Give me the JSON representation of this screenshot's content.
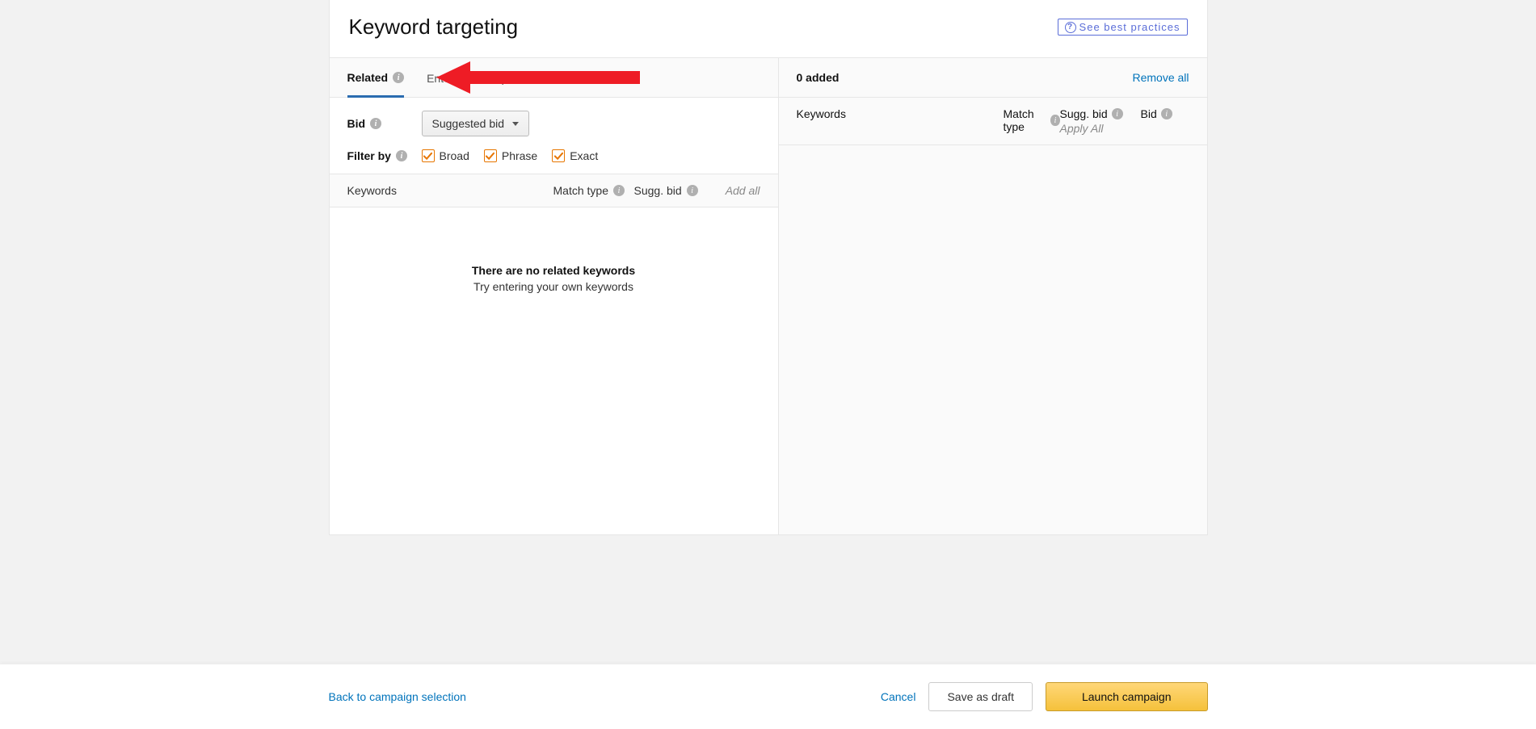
{
  "header": {
    "title": "Keyword targeting",
    "best_practices": "See best practices"
  },
  "tabs": {
    "related": "Related",
    "enter_list": "Enter list",
    "upload_file": "Upload file"
  },
  "controls": {
    "bid_label": "Bid",
    "bid_select": "Suggested bid",
    "filter_label": "Filter by",
    "filters": {
      "broad": "Broad",
      "phrase": "Phrase",
      "exact": "Exact"
    }
  },
  "left_grid": {
    "col_keywords": "Keywords",
    "col_match_type": "Match type",
    "col_sugg_bid": "Sugg. bid",
    "add_all": "Add all"
  },
  "empty_state": {
    "title": "There are no related keywords",
    "subtitle": "Try entering your own keywords"
  },
  "right_panel": {
    "added": "0 added",
    "remove_all": "Remove all",
    "col_keywords": "Keywords",
    "col_match_type": "Match type",
    "col_sugg_bid": "Sugg. bid",
    "apply_all": "Apply All",
    "col_bid": "Bid"
  },
  "footer": {
    "back": "Back to campaign selection",
    "cancel": "Cancel",
    "save_draft": "Save as draft",
    "launch": "Launch campaign"
  }
}
